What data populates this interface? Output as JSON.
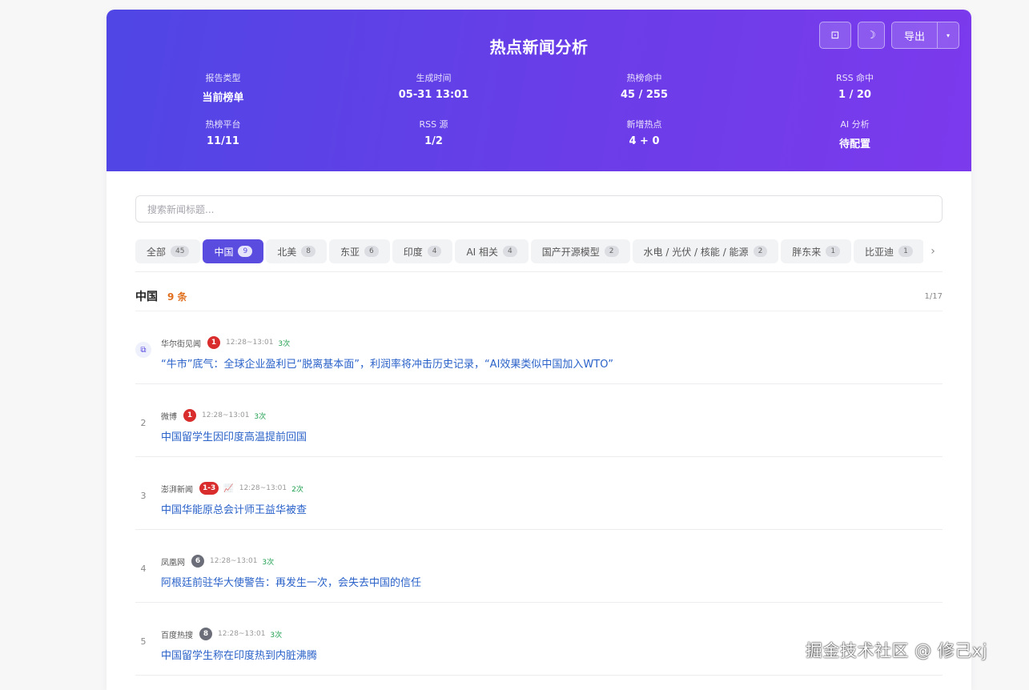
{
  "header": {
    "title": "热点新闻分析",
    "screenshot_btn": "⊡",
    "theme_btn": "☽",
    "export_label": "导出",
    "export_caret": "▾",
    "stats": [
      {
        "label": "报告类型",
        "value": "当前榜单"
      },
      {
        "label": "生成时间",
        "value": "05-31 13:01"
      },
      {
        "label": "热榜命中",
        "value": "45 / 255"
      },
      {
        "label": "RSS 命中",
        "value": "1 / 20"
      },
      {
        "label": "热榜平台",
        "value": "11/11"
      },
      {
        "label": "RSS 源",
        "value": "1/2"
      },
      {
        "label": "新增热点",
        "value": "4 + 0"
      },
      {
        "label": "AI 分析",
        "value": "待配置"
      }
    ]
  },
  "search": {
    "placeholder": "搜索新闻标题..."
  },
  "tabs": [
    {
      "label": "全部",
      "count": "45"
    },
    {
      "label": "中国",
      "count": "9"
    },
    {
      "label": "北美",
      "count": "8"
    },
    {
      "label": "东亚",
      "count": "6"
    },
    {
      "label": "印度",
      "count": "4"
    },
    {
      "label": "AI 相关",
      "count": "4"
    },
    {
      "label": "国产开源模型",
      "count": "2"
    },
    {
      "label": "水电 / 光伏 / 核能 / 能源",
      "count": "2"
    },
    {
      "label": "胖东来",
      "count": "1"
    },
    {
      "label": "比亚迪",
      "count": "1"
    }
  ],
  "tab_arrow": "›",
  "section": {
    "name": "中国",
    "count": "9 条",
    "page": "1/17"
  },
  "items": [
    {
      "num": "⧉",
      "source": "华尔街见闻",
      "rank": "1",
      "trend": "",
      "time": "12:28~13:01",
      "times": "3次",
      "title": "“牛市”底气：全球企业盈利已“脱离基本面”，利润率将冲击历史记录，“AI效果类似中国加入WTO”"
    },
    {
      "num": "2",
      "source": "微博",
      "rank": "1",
      "trend": "",
      "time": "12:28~13:01",
      "times": "3次",
      "title": "中国留学生因印度高温提前回国"
    },
    {
      "num": "3",
      "source": "澎湃新闻",
      "rank": "1-3",
      "trend": "📈",
      "time": "12:28~13:01",
      "times": "2次",
      "title": "中国华能原总会计师王益华被查"
    },
    {
      "num": "4",
      "source": "凤凰网",
      "rank": "6",
      "trend": "",
      "time": "12:28~13:01",
      "times": "3次",
      "title": "阿根廷前驻华大使警告：再发生一次，会失去中国的信任"
    },
    {
      "num": "5",
      "source": "百度热搜",
      "rank": "8",
      "trend": "",
      "time": "12:28~13:01",
      "times": "3次",
      "title": "中国留学生称在印度热到内脏沸腾"
    }
  ],
  "watermark": "掘金技术社区 @ 修己xj",
  "colors": {
    "header_start": "#4f46e5",
    "header_end": "#7c3aed",
    "accent": "#5b4ce0",
    "rank_red": "#d92c2c",
    "rank_gray": "#6b6e78",
    "link": "#2a62c9"
  }
}
